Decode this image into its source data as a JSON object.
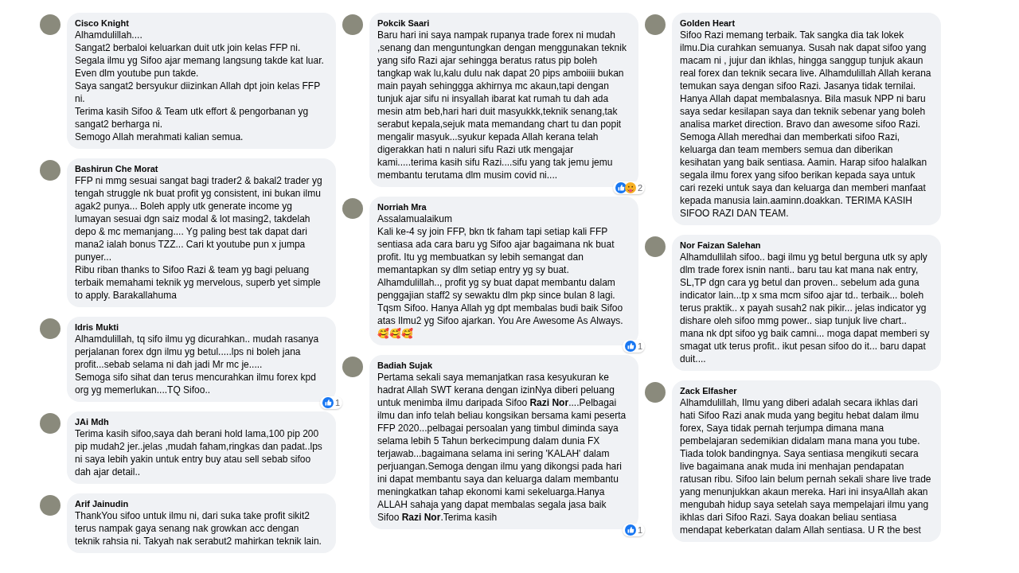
{
  "columns": [
    {
      "comments": [
        {
          "author": "Cisco Knight",
          "paragraphs": [
            "Alhamdulillah....",
            "Sangat2 berbaloi keluarkan duit utk join kelas FFP ni.",
            "Segala ilmu yg Sifoo ajar memang langsung takde kat luar. Even dlm youtube pun takde.",
            "Saya sangat2 bersyukur diizinkan Allah dpt join kelas FFP ni.",
            "Terima kasih Sifoo & Team utk effort & pengorbanan yg sangat2 berharga ni.",
            "Semogo Allah merahmati kalian semua."
          ]
        },
        {
          "author": "Bashirun Che Morat",
          "paragraphs": [
            "FFP ni mmg sesuai sangat bagi trader2 & bakal2 trader yg tengah struggle nk buat profit yg consistent, ini bukan ilmu agak2 punya... Boleh apply utk generate income yg lumayan sesuai dgn saiz modal & lot masing2, takdelah depo & mc memanjang.... Yg paling best tak dapat dari mana2 ialah bonus TZZ... Cari kt youtube pun x jumpa punyer...",
            "Ribu riban thanks to Sifoo Razi & team yg bagi peluang terbaik memahami teknik yg mervelous, superb yet simple to apply. Barakallahuma"
          ]
        },
        {
          "author": "Idris Mukti",
          "paragraphs": [
            "Alhamdulillah, tq sifo ilmu yg dicurahkan.. mudah rasanya perjalanan forex dgn ilmu yg betul.....lps ni boleh jana profit...sebab selama ni dah jadi Mr mc je.....",
            "Semoga sifo sihat dan terus mencurahkan ilmu forex kpd org yg memerlukan....TQ Sifoo.."
          ],
          "reactions": {
            "like": true,
            "care": false,
            "count": "1"
          }
        },
        {
          "author": "JAi Mdh",
          "paragraphs": [
            "Terima kasih sifoo,saya dah berani hold lama,100 pip 200 pip mudah2 jer..jelas ,mudah faham,ringkas dan padat..lps ni saya lebih yakin untuk entry buy atau sell sebab sifoo dah ajar detail.."
          ]
        },
        {
          "author": "Arif Jainudin",
          "paragraphs": [
            "ThankYou sifoo untuk ilmu ni, dari suka take profit sikit2 terus nampak gaya senang nak growkan acc dengan teknik rahsia ni. Takyah nak serabut2 mahirkan teknik lain."
          ]
        }
      ]
    },
    {
      "comments": [
        {
          "author": "Pokcik Saari",
          "paragraphs": [
            "Baru hari ini saya nampak rupanya trade forex ni mudah ,senang dan menguntungkan dengan menggunakan teknik yang sifo Razi ajar sehingga beratus ratus pip boleh tangkap wak lu,kalu dulu nak dapat 20 pips amboiiii bukan main payah sehinggga akhirnya mc akaun,tapi dengan tunjuk ajar sifu ni insyallah ibarat kat rumah tu dah ada mesin atm beb,hari hari duit masyukkk,teknik senang,tak serabut kepala,sejuk mata memandang chart tu dan popit mengalir masyuk...syukur kepada Allah kerana telah digerakkan hati n naluri sifu Razi utk mengajar kami.....terima kasih sifu Razi....sifu yang tak jemu jemu membantu terutama dlm musim covid ni...."
          ],
          "reactions": {
            "like": true,
            "care": true,
            "count": "2"
          }
        },
        {
          "author": "Norriah Mra",
          "paragraphs": [
            "Assalamualaikum",
            "Kali ke-4 sy join FFP, bkn tk faham tapi setiap kali FFP sentiasa ada cara baru yg Sifoo ajar bagaimana nk buat profit. Itu yg membuatkan sy lebih semangat dan memantapkan sy dlm setiap entry yg sy buat.",
            "Alhamdulillah.., profit yg sy buat dapat membantu dalam penggajian staff2 sy sewaktu dlm pkp since bulan 8 lagi.",
            "Tqsm Sifoo. Hanya Allah yg dpt membalas budi baik Sifoo atas Ilmu2 yg Sifoo ajarkan. You Are Awesome As Always. 🥰🥰🥰"
          ],
          "reactions": {
            "like": true,
            "care": false,
            "count": "1"
          }
        },
        {
          "author": "Badiah Sujak",
          "paragraphs": [
            "Pertama sekali saya memanjatkan rasa kesyukuran ke hadrat Allah SWT kerana dengan izinNya diberi peluang untuk menimba ilmu daripada Sifoo **Razi Nor**....Pelbagai ilmu dan info telah beliau kongsikan bersama kami peserta FFP 2020...pelbagai persoalan yang timbul diminda saya selama lebih 5 Tahun berkecimpung dalam dunia FX terjawab...bagaimana selama ini sering 'KALAH' dalam perjuangan.Semoga dengan ilmu yang dikongsi pada hari ini dapat membantu saya dan keluarga dalam membantu meningkatkan tahap ekonomi kami sekeluarga.Hanya ALLAH sahaja yang dapat membalas segala jasa baik Sifoo **Razi Nor**.Terima kasih"
          ],
          "reactions": {
            "like": true,
            "care": false,
            "count": "1"
          }
        }
      ]
    },
    {
      "comments": [
        {
          "author": "Golden Heart",
          "paragraphs": [
            "Sifoo Razi memang terbaik. Tak sangka dia tak lokek ilmu.Dia curahkan semuanya. Susah nak dapat sifoo yang macam ni , jujur dan ikhlas, hingga sanggup tunjuk akaun real forex dan teknik secara live. Alhamdulillah Allah kerana temukan saya dengan sifoo Razi. Jasanya tidak ternilai. Hanya Allah dapat membalasnya. Bila masuk NPP ni baru saya sedar kesilapan saya dan teknik sebenar yang boleh analisa market direction. Bravo dan awesome sifoo Razi. Semoga Allah meredhai dan memberkati sifoo Razi, keluarga dan team members semua dan diberikan kesihatan yang baik sentiasa. Aamin. Harap sifoo halalkan segala ilmu forex yang sifoo berikan kepada saya untuk cari rezeki untuk saya dan keluarga dan memberi manfaat kepada manusia lain.aaminn.doakkan. TERIMA KASIH SIFOO RAZI DAN TEAM."
          ]
        },
        {
          "author": "Nor Faizan Salehan",
          "paragraphs": [
            "Alhamdullilah sifoo.. bagi ilmu yg betul berguna utk sy aply dlm trade forex isnin nanti.. baru tau kat mana nak entry, SL,TP dgn cara yg betul dan proven.. sebelum ada guna indicator lain...tp x sma mcm sifoo ajar td.. terbaik... boleh terus praktik.. x payah susah2 nak pikir... jelas indicator yg dishare oleh sifoo mmg power.. siap tunjuk live chart.. mana nk dpt sifoo yg baik camni... moga dapat memberi sy smagat utk terus profit.. ikut pesan sifoo do it... baru dapat duit...."
          ]
        },
        {
          "author": "Zack Elfasher",
          "paragraphs": [
            "Alhamdulillah, Ilmu yang diberi adalah secara ikhlas dari hati Sifoo Razi anak muda yang begitu hebat dalam ilmu forex, Saya tidak pernah terjumpa dimana mana pembelajaran sedemikian didalam mana mana you tube. Tiada tolok bandingnya. Saya sentiasa mengikuti secara live bagaimana anak muda ini menhajan pendapatan ratusan ribu. Sifoo lain belum pernah sekali share live trade yang menunjukkan akaun mereka. Hari ini insyaAllah akan mengubah hidup saya setelah saya mempelajari ilmu yang ikhlas dari Sifoo Razi. Saya doakan beliau sentiasa mendapat keberkatan dalam Allah sentiasa. U R the best"
          ]
        }
      ]
    }
  ]
}
